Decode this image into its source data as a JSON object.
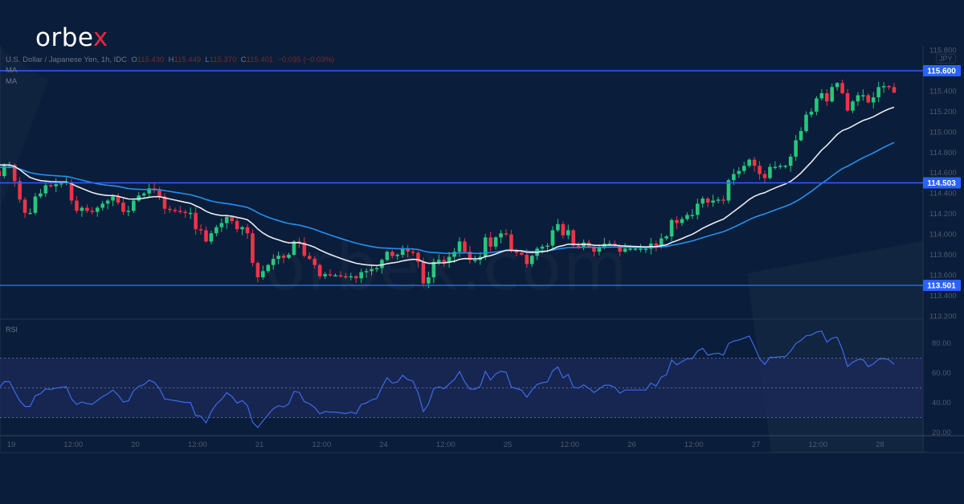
{
  "brand": {
    "logo_main": "orbe",
    "logo_x": "x",
    "watermark": "orbex.com"
  },
  "legend": {
    "symbol": "U.S. Dollar / Japanese Yen, 1h, IDC",
    "open_label": "O",
    "open": "115.430",
    "high_label": "H",
    "high": "115.449",
    "low_label": "L",
    "low": "115.370",
    "close_label": "C",
    "close": "115.401",
    "change": "−0.035 (−0.03%)",
    "ma1": "MA",
    "ma2": "MA"
  },
  "colors": {
    "background": "#0a1d3a",
    "up": "#26c77a",
    "down": "#ef3347",
    "ma_fast": "#e9ecef",
    "ma_slow": "#2490ee",
    "level": "#2962ff",
    "rsi": "#3d6ae6",
    "rsi_band": "#1c2a5a"
  },
  "chart_data": {
    "type": "candlestick",
    "symbol": "USDJPY",
    "interval": "1h",
    "currency": "JPY",
    "price_axis": {
      "ticks": [
        "115.800",
        "115.400",
        "115.200",
        "115.000",
        "114.800",
        "114.600",
        "114.400",
        "114.200",
        "114.000",
        "113.800",
        "113.600",
        "113.400",
        "113.200"
      ],
      "range": [
        113.16,
        115.84
      ]
    },
    "levels": [
      {
        "value": 115.6,
        "label": "115.600"
      },
      {
        "value": 114.503,
        "label": "114.503"
      },
      {
        "value": 113.501,
        "label": "113.501"
      }
    ],
    "time_axis": [
      "19",
      "12:00",
      "20",
      "12:00",
      "21",
      "12:00",
      "24",
      "12:00",
      "25",
      "12:00",
      "26",
      "12:00",
      "27",
      "12:00",
      "28"
    ],
    "closes": [
      114.57,
      114.68,
      114.68,
      114.52,
      114.34,
      114.21,
      114.21,
      114.37,
      114.4,
      114.48,
      114.47,
      114.49,
      114.5,
      114.51,
      114.33,
      114.23,
      114.26,
      114.23,
      114.22,
      114.26,
      114.3,
      114.33,
      114.37,
      114.31,
      114.22,
      114.23,
      114.33,
      114.38,
      114.4,
      114.45,
      114.43,
      114.37,
      114.25,
      114.24,
      114.23,
      114.22,
      114.21,
      114.21,
      114.05,
      114.04,
      113.93,
      114.01,
      114.07,
      114.11,
      114.17,
      114.13,
      114.05,
      114.07,
      114.01,
      113.72,
      113.58,
      113.64,
      113.7,
      113.76,
      113.79,
      113.77,
      113.8,
      113.93,
      113.92,
      113.79,
      113.76,
      113.7,
      113.59,
      113.61,
      113.6,
      113.6,
      113.59,
      113.58,
      113.59,
      113.57,
      113.63,
      113.64,
      113.66,
      113.67,
      113.75,
      113.83,
      113.79,
      113.8,
      113.86,
      113.83,
      113.82,
      113.73,
      113.52,
      113.58,
      113.73,
      113.75,
      113.73,
      113.78,
      113.83,
      113.93,
      113.83,
      113.75,
      113.75,
      113.78,
      113.97,
      113.88,
      113.97,
      114.01,
      114.0,
      113.84,
      113.82,
      113.8,
      113.71,
      113.79,
      113.86,
      113.88,
      113.89,
      114.04,
      114.1,
      113.99,
      114.04,
      113.89,
      113.88,
      113.92,
      113.88,
      113.83,
      113.87,
      113.91,
      113.91,
      113.89,
      113.83,
      113.86,
      113.86,
      113.86,
      113.86,
      113.86,
      113.91,
      113.89,
      113.96,
      113.98,
      114.14,
      114.11,
      114.15,
      114.19,
      114.19,
      114.3,
      114.35,
      114.31,
      114.33,
      114.34,
      114.33,
      114.53,
      114.59,
      114.62,
      114.67,
      114.73,
      114.67,
      114.59,
      114.55,
      114.66,
      114.66,
      114.67,
      114.67,
      114.76,
      114.92,
      115.01,
      115.17,
      115.2,
      115.33,
      115.38,
      115.3,
      115.44,
      115.48,
      115.38,
      115.21,
      115.3,
      115.36,
      115.36,
      115.29,
      115.34,
      115.44,
      115.45,
      115.44,
      115.4
    ],
    "indicators": [
      {
        "name": "MA",
        "color": "white"
      },
      {
        "name": "MA",
        "color": "blue"
      },
      {
        "name": "RSI",
        "levels": [
          70,
          50,
          30
        ],
        "axis_ticks": [
          "80.00",
          "60.00",
          "40.00",
          "20.00"
        ],
        "range": [
          20,
          80
        ]
      }
    ]
  }
}
